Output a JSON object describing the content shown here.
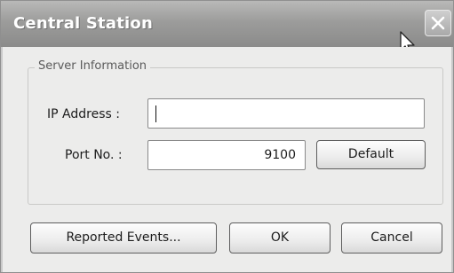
{
  "window": {
    "title": "Central Station"
  },
  "titlebar": {
    "close_icon": "close-icon",
    "close_glyph": "✕"
  },
  "server_info": {
    "legend": "Server Information",
    "ip_label": "IP Address :",
    "ip_value": "",
    "port_label": "Port No. :",
    "port_value": "9100",
    "default_label": "Default"
  },
  "footer": {
    "reported_events_label": "Reported Events...",
    "ok_label": "OK",
    "cancel_label": "Cancel"
  },
  "colors": {
    "titlebar": "#9c9c9b",
    "dialog_bg": "#ececeb",
    "button_border": "#5e5e5e"
  }
}
